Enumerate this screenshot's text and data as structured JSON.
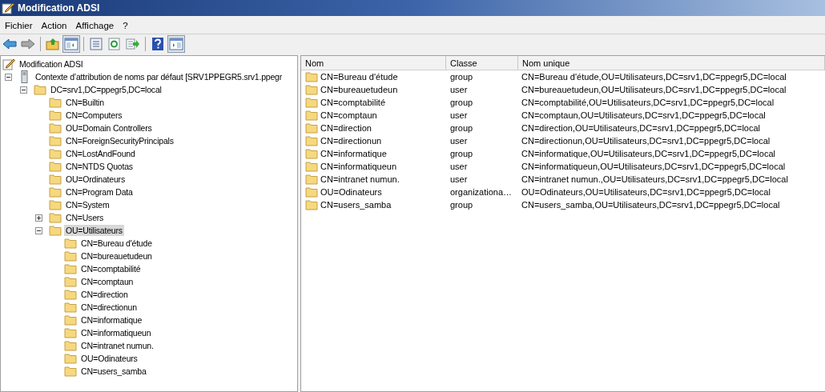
{
  "window": {
    "title": "Modification ADSI"
  },
  "menu": [
    "Fichier",
    "Action",
    "Affichage",
    "?"
  ],
  "toolbar": [
    {
      "kind": "back",
      "pressed": false
    },
    {
      "kind": "forward",
      "pressed": false
    },
    {
      "kind": "separator"
    },
    {
      "kind": "up",
      "pressed": false
    },
    {
      "kind": "tree",
      "pressed": true
    },
    {
      "kind": "separator"
    },
    {
      "kind": "properties",
      "pressed": false
    },
    {
      "kind": "refresh",
      "pressed": false
    },
    {
      "kind": "export",
      "pressed": false
    },
    {
      "kind": "separator"
    },
    {
      "kind": "help",
      "pressed": false
    },
    {
      "kind": "actions",
      "pressed": true
    }
  ],
  "tree": {
    "label": "Modification ADSI",
    "kind": "root",
    "selected": false,
    "children": [
      {
        "label": "Contexte d’attribution de noms par défaut [SRV1PPEGR5.srv1.ppegr",
        "kind": "server",
        "expanded": true,
        "selected": false,
        "children": [
          {
            "label": "DC=srv1,DC=ppegr5,DC=local",
            "kind": "folder",
            "expanded": true,
            "selected": false,
            "children": [
              {
                "label": "CN=Builtin",
                "kind": "folder",
                "selected": false
              },
              {
                "label": "CN=Computers",
                "kind": "folder",
                "selected": false
              },
              {
                "label": "OU=Domain Controllers",
                "kind": "folder",
                "selected": false
              },
              {
                "label": "CN=ForeignSecurityPrincipals",
                "kind": "folder",
                "selected": false
              },
              {
                "label": "CN=LostAndFound",
                "kind": "folder",
                "selected": false
              },
              {
                "label": "CN=NTDS Quotas",
                "kind": "folder",
                "selected": false
              },
              {
                "label": "OU=Ordinateurs",
                "kind": "folder",
                "selected": false
              },
              {
                "label": "CN=Program Data",
                "kind": "folder",
                "selected": false
              },
              {
                "label": "CN=System",
                "kind": "folder",
                "selected": false
              },
              {
                "label": "CN=Users",
                "kind": "folder",
                "expanded": false,
                "selected": false
              },
              {
                "label": "OU=Utilisateurs",
                "kind": "folder",
                "expanded": true,
                "selected": true,
                "children": [
                  {
                    "label": "CN=Bureau d'étude",
                    "kind": "folder",
                    "selected": false
                  },
                  {
                    "label": "CN=bureauetudeun",
                    "kind": "folder",
                    "selected": false
                  },
                  {
                    "label": "CN=comptabilité",
                    "kind": "folder",
                    "selected": false
                  },
                  {
                    "label": "CN=comptaun",
                    "kind": "folder",
                    "selected": false
                  },
                  {
                    "label": "CN=direction",
                    "kind": "folder",
                    "selected": false
                  },
                  {
                    "label": "CN=directionun",
                    "kind": "folder",
                    "selected": false
                  },
                  {
                    "label": "CN=informatique",
                    "kind": "folder",
                    "selected": false
                  },
                  {
                    "label": "CN=informatiqueun",
                    "kind": "folder",
                    "selected": false
                  },
                  {
                    "label": "CN=intranet numun.",
                    "kind": "folder",
                    "selected": false
                  },
                  {
                    "label": "OU=Odinateurs",
                    "kind": "folder",
                    "selected": false
                  },
                  {
                    "label": "CN=users_samba",
                    "kind": "folder",
                    "selected": false
                  }
                ]
              }
            ]
          }
        ]
      }
    ]
  },
  "table": {
    "columns": [
      "Nom",
      "Classe",
      "Nom unique"
    ],
    "rows": [
      {
        "name": "CN=Bureau d'étude",
        "class": "group",
        "dn": "CN=Bureau d'étude,OU=Utilisateurs,DC=srv1,DC=ppegr5,DC=local"
      },
      {
        "name": "CN=bureauetudeun",
        "class": "user",
        "dn": "CN=bureauetudeun,OU=Utilisateurs,DC=srv1,DC=ppegr5,DC=local"
      },
      {
        "name": "CN=comptabilité",
        "class": "group",
        "dn": "CN=comptabilité,OU=Utilisateurs,DC=srv1,DC=ppegr5,DC=local"
      },
      {
        "name": "CN=comptaun",
        "class": "user",
        "dn": "CN=comptaun,OU=Utilisateurs,DC=srv1,DC=ppegr5,DC=local"
      },
      {
        "name": "CN=direction",
        "class": "group",
        "dn": "CN=direction,OU=Utilisateurs,DC=srv1,DC=ppegr5,DC=local"
      },
      {
        "name": "CN=directionun",
        "class": "user",
        "dn": "CN=directionun,OU=Utilisateurs,DC=srv1,DC=ppegr5,DC=local"
      },
      {
        "name": "CN=informatique",
        "class": "group",
        "dn": "CN=informatique,OU=Utilisateurs,DC=srv1,DC=ppegr5,DC=local"
      },
      {
        "name": "CN=informatiqueun",
        "class": "user",
        "dn": "CN=informatiqueun,OU=Utilisateurs,DC=srv1,DC=ppegr5,DC=local"
      },
      {
        "name": "CN=intranet numun.",
        "class": "user",
        "dn": "CN=intranet numun.,OU=Utilisateurs,DC=srv1,DC=ppegr5,DC=local"
      },
      {
        "name": "OU=Odinateurs",
        "class": "organizationa…",
        "dn": "OU=Odinateurs,OU=Utilisateurs,DC=srv1,DC=ppegr5,DC=local"
      },
      {
        "name": "CN=users_samba",
        "class": "group",
        "dn": "CN=users_samba,OU=Utilisateurs,DC=srv1,DC=ppegr5,DC=local"
      }
    ]
  }
}
